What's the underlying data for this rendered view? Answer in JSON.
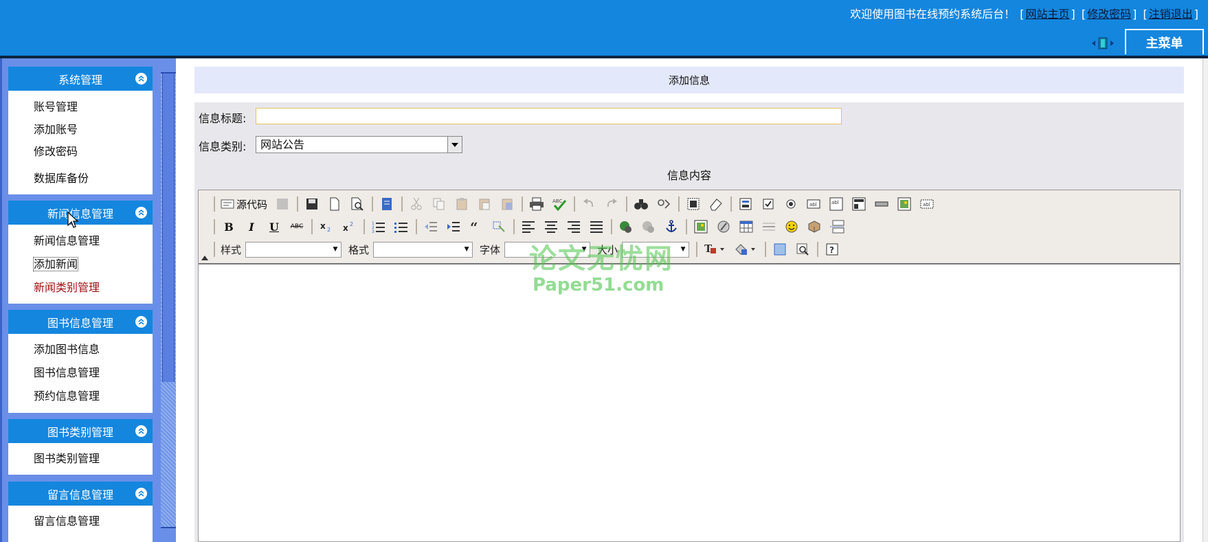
{
  "header": {
    "welcome_text": "欢迎使用图书在线预约系统后台！",
    "links": [
      {
        "label": "网站主页"
      },
      {
        "label": "修改密码"
      },
      {
        "label": "注销退出"
      }
    ],
    "main_menu_label": "主菜单"
  },
  "sidebar": {
    "groups": [
      {
        "title": "系统管理",
        "items": [
          "账号管理",
          "添加账号",
          "修改密码",
          "数据库备份"
        ]
      },
      {
        "title": "新闻信息管理",
        "items": [
          "新闻信息管理",
          "添加新闻",
          "新闻类别管理"
        ]
      },
      {
        "title": "图书信息管理",
        "items": [
          "添加图书信息",
          "图书信息管理",
          "预约信息管理"
        ]
      },
      {
        "title": "图书类别管理",
        "items": [
          "图书类别管理"
        ]
      },
      {
        "title": "留言信息管理",
        "items": [
          "留言信息管理"
        ]
      }
    ],
    "active_item": "新闻类别管理",
    "focused_item": "添加新闻"
  },
  "form": {
    "panel_title": "添加信息",
    "title_label": "信息标题:",
    "title_value": "",
    "category_label": "信息类别:",
    "category_value": "网站公告",
    "content_heading": "信息内容"
  },
  "editor": {
    "source_label": "源代码",
    "style_label": "样式",
    "format_label": "格式",
    "font_label": "字体",
    "size_label": "大小",
    "bold": "B",
    "italic": "I",
    "underline": "U",
    "strike": "ABC"
  },
  "watermark": {
    "cn": "论文无忧网",
    "en": "Paper51.com"
  },
  "colors": {
    "header_bg": "#1486de",
    "sidebar_bg": "#6a8fe8",
    "active_item": "#a01010",
    "panel_title_bg": "#e4e8fb"
  }
}
